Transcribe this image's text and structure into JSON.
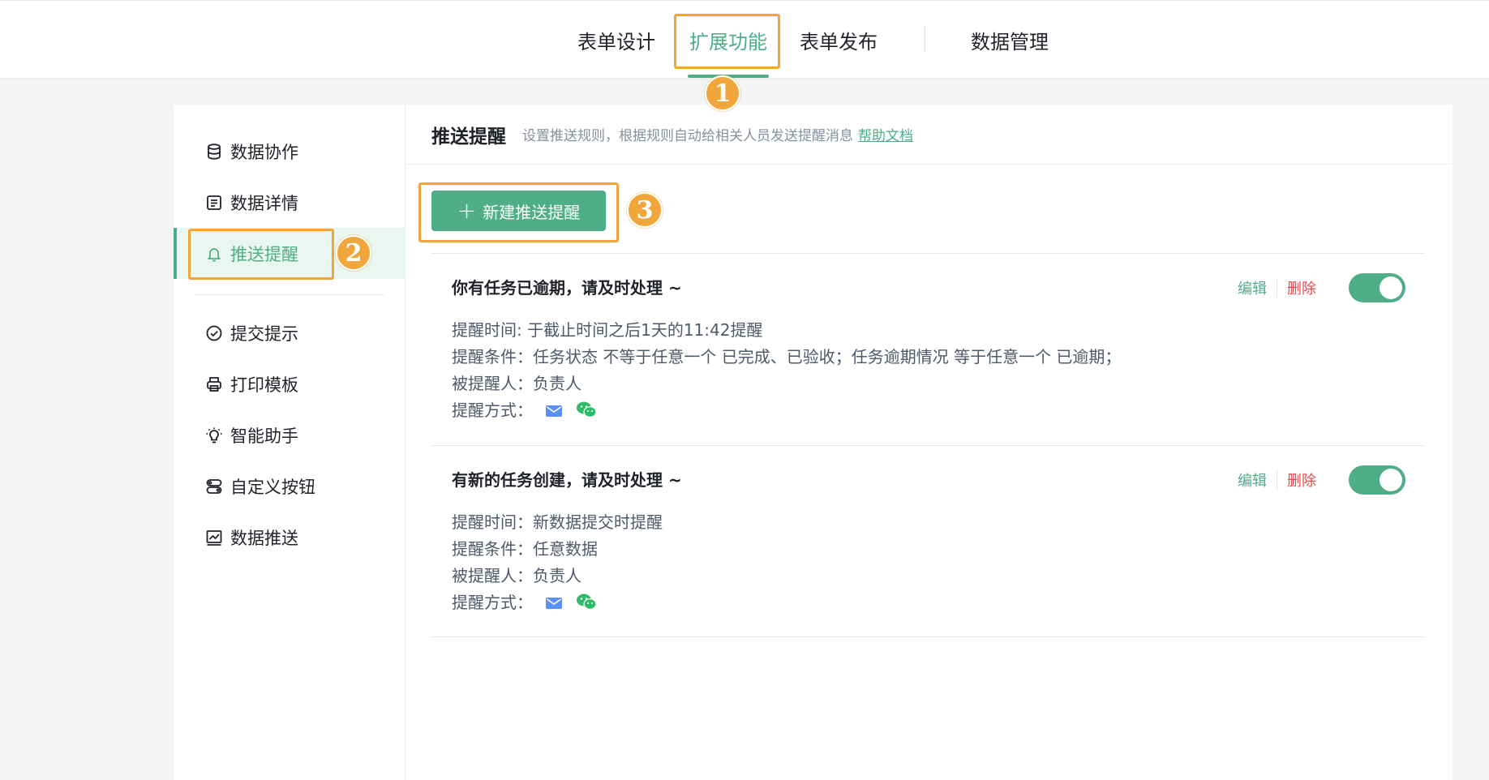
{
  "nav": {
    "tabs": [
      {
        "label": "表单设计"
      },
      {
        "label": "扩展功能"
      },
      {
        "label": "表单发布"
      },
      {
        "label": "数据管理"
      }
    ],
    "active_index": 1
  },
  "annotations": {
    "badge1": "1",
    "badge2": "2",
    "badge3": "3"
  },
  "sidebar": {
    "items": [
      {
        "label": "数据协作",
        "icon": "database-icon"
      },
      {
        "label": "数据详情",
        "icon": "document-icon"
      },
      {
        "label": "推送提醒",
        "icon": "bell-icon"
      },
      {
        "label": "提交提示",
        "icon": "check-circle-icon"
      },
      {
        "label": "打印模板",
        "icon": "printer-icon"
      },
      {
        "label": "智能助手",
        "icon": "lightbulb-icon"
      },
      {
        "label": "自定义按钮",
        "icon": "toggle-buttons-icon"
      },
      {
        "label": "数据推送",
        "icon": "chart-line-icon"
      }
    ],
    "active_index": 2
  },
  "main": {
    "title": "推送提醒",
    "description": "设置推送规则，根据规则自动给相关人员发送提醒消息",
    "help_link": "帮助文档",
    "new_button": "新建推送提醒",
    "rules": [
      {
        "title": "你有任务已逾期，请及时处理 ~",
        "time_label": "提醒时间: ",
        "time_value": "于截止时间之后1天的11:42提醒",
        "cond_label": "提醒条件：",
        "cond_value": "任务状态 不等于任意一个 已完成、已验收；任务逾期情况 等于任意一个 已逾期；",
        "recipient_label": "被提醒人：",
        "recipient_value": "负责人",
        "method_label": "提醒方式：",
        "edit": "编辑",
        "delete": "删除",
        "enabled": true
      },
      {
        "title": "有新的任务创建，请及时处理 ~",
        "time_label": "提醒时间：",
        "time_value": "新数据提交时提醒",
        "cond_label": "提醒条件：",
        "cond_value": "任意数据",
        "recipient_label": "被提醒人：",
        "recipient_value": "负责人",
        "method_label": "提醒方式：",
        "edit": "编辑",
        "delete": "删除",
        "enabled": true
      }
    ]
  },
  "colors": {
    "accent": "#4fae87",
    "annotation": "#f0a63a",
    "danger": "#e5484d",
    "mail": "#5b8ff9",
    "wechat": "#2fbc6a"
  }
}
